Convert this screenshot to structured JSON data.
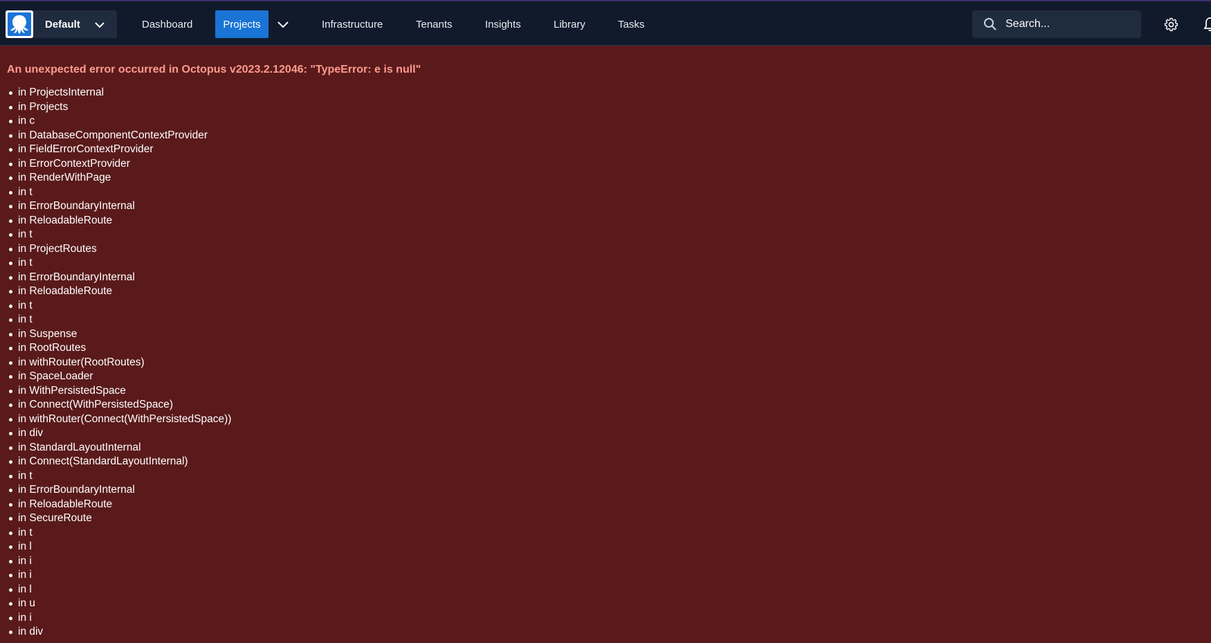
{
  "header": {
    "space": {
      "name": "Default"
    },
    "nav": [
      {
        "label": "Dashboard"
      },
      {
        "label": "Projects"
      },
      {
        "label": "Infrastructure"
      },
      {
        "label": "Tenants"
      },
      {
        "label": "Insights"
      },
      {
        "label": "Library"
      },
      {
        "label": "Tasks"
      }
    ],
    "active_nav": "Projects",
    "search": {
      "placeholder": "Search..."
    },
    "colors": {
      "bar": "#111a2b",
      "active": "#1a74d6",
      "page": "#5a1a1b",
      "error_text": "#ff9b8e"
    }
  },
  "error": {
    "title": "An unexpected error occurred in Octopus v2023.2.12046: \"TypeError: e is null\"",
    "stack": [
      "in ProjectsInternal",
      "in Projects",
      "in c",
      "in DatabaseComponentContextProvider",
      "in FieldErrorContextProvider",
      "in ErrorContextProvider",
      "in RenderWithPage",
      "in t",
      "in ErrorBoundaryInternal",
      "in ReloadableRoute",
      "in t",
      "in ProjectRoutes",
      "in t",
      "in ErrorBoundaryInternal",
      "in ReloadableRoute",
      "in t",
      "in t",
      "in Suspense",
      "in RootRoutes",
      "in withRouter(RootRoutes)",
      "in SpaceLoader",
      "in WithPersistedSpace",
      "in Connect(WithPersistedSpace)",
      "in withRouter(Connect(WithPersistedSpace))",
      "in div",
      "in StandardLayoutInternal",
      "in Connect(StandardLayoutInternal)",
      "in t",
      "in ErrorBoundaryInternal",
      "in ReloadableRoute",
      "in SecureRoute",
      "in t",
      "in l",
      "in i",
      "in i",
      "in l",
      "in u",
      "in i",
      "in div"
    ]
  }
}
